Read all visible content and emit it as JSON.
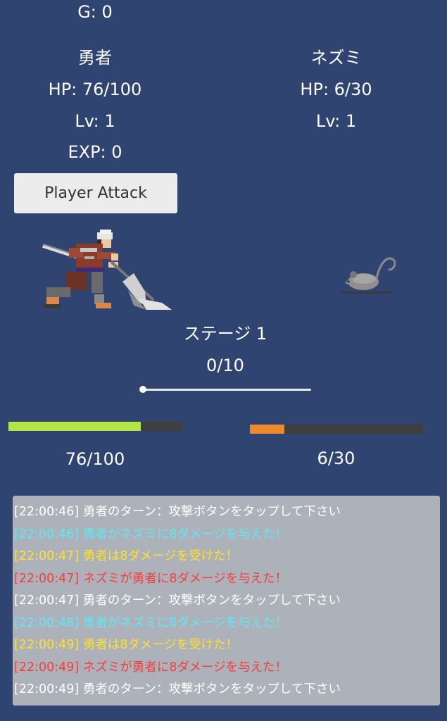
{
  "gold": "G: 0",
  "player": {
    "name": "勇者",
    "hp": "HP: 76/100",
    "level": "Lv: 1",
    "exp": "EXP: 0",
    "hp_bar_text": "76/100",
    "hp_current": 76,
    "hp_max": 100,
    "bar_color": "#b3e544"
  },
  "enemy": {
    "name": "ネズミ",
    "hp": "HP: 6/30",
    "level": "Lv: 1",
    "hp_bar_text": "6/30",
    "hp_current": 6,
    "hp_max": 30,
    "bar_color": "#ef8a2a"
  },
  "actions": {
    "attack_label": "Player Attack"
  },
  "stage": {
    "title": "ステージ 1",
    "progress_text": "0/10",
    "progress": 0
  },
  "colors": {
    "background": "#2f4471",
    "log_panel": "#adb1b9",
    "log_normal": "#ffffff",
    "log_player_attack": "#5ee9f7",
    "log_damage_taken": "#ffe12e",
    "log_enemy_attack": "#f53d3d"
  },
  "log": [
    {
      "time": "[22:00:46]",
      "text": "勇者のターン：攻撃ボタンをタップして下さい",
      "kind": "normal"
    },
    {
      "time": "[22:00:46]",
      "text": "勇者がネズミに8ダメージを与えた！",
      "kind": "player_attack"
    },
    {
      "time": "[22:00:47]",
      "text": "勇者は8ダメージを受けた！",
      "kind": "damage_taken"
    },
    {
      "time": "[22:00:47]",
      "text": "ネズミが勇者に8ダメージを与えた！",
      "kind": "enemy_attack"
    },
    {
      "time": "[22:00:47]",
      "text": "勇者のターン：攻撃ボタンをタップして下さい",
      "kind": "normal"
    },
    {
      "time": "[22:00:48]",
      "text": "勇者がネズミに8ダメージを与えた！",
      "kind": "player_attack"
    },
    {
      "time": "[22:00:49]",
      "text": "勇者は8ダメージを受けた！",
      "kind": "damage_taken"
    },
    {
      "time": "[22:00:49]",
      "text": "ネズミが勇者に8ダメージを与えた！",
      "kind": "enemy_attack"
    },
    {
      "time": "[22:00:49]",
      "text": "勇者のターン：攻撃ボタンをタップして下さい",
      "kind": "normal"
    }
  ]
}
